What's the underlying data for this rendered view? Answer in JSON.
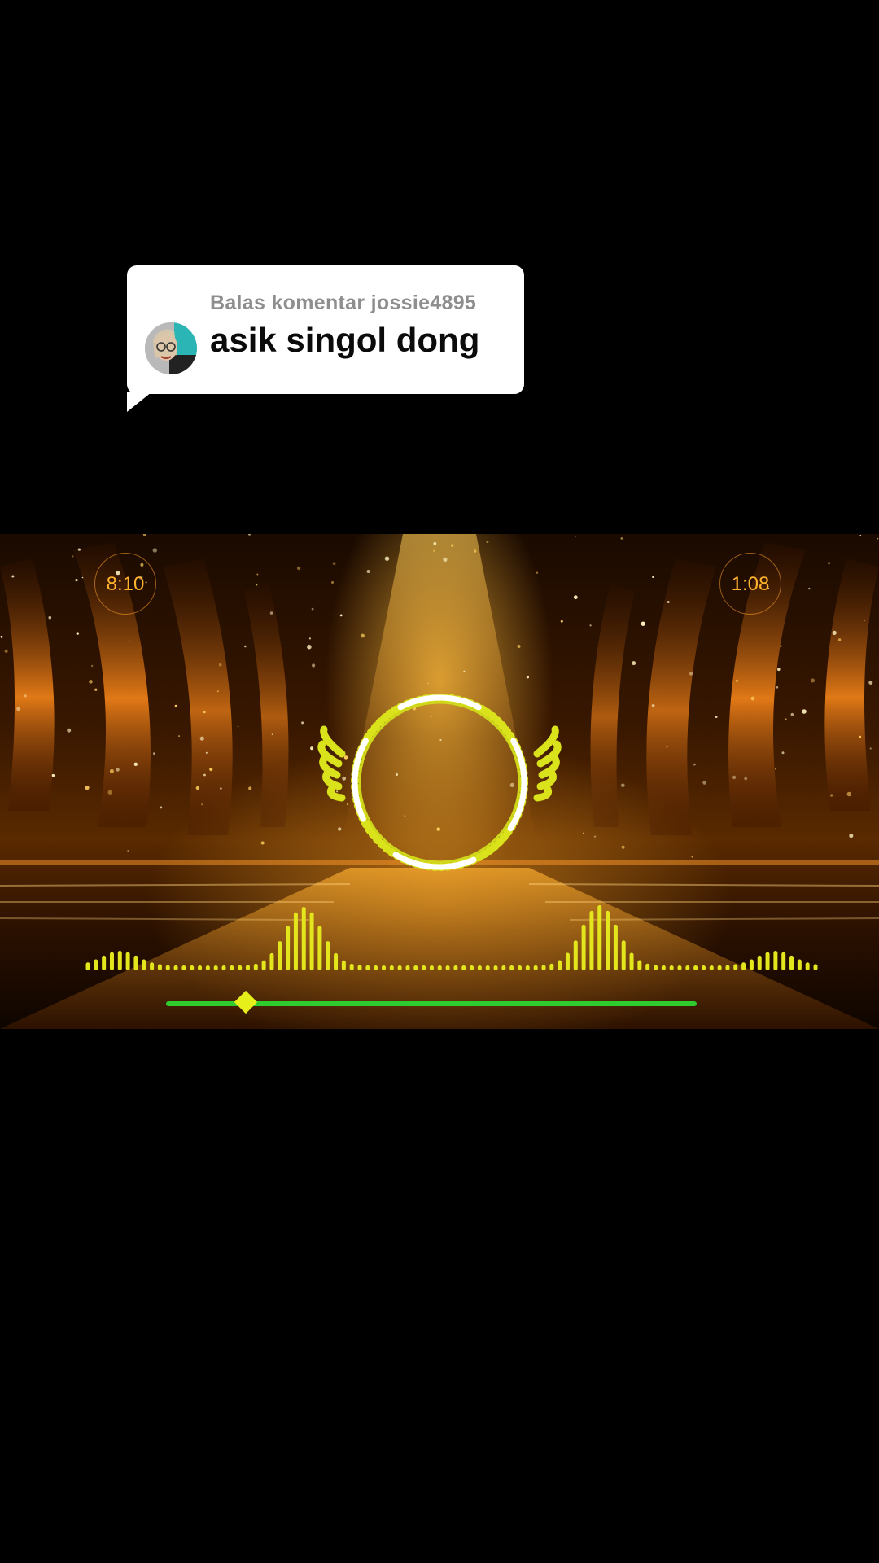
{
  "reply_comment": {
    "header": "Balas komentar jossie4895",
    "text": "asik singol dong",
    "avatar_icon": "user-avatar"
  },
  "player": {
    "elapsed_time": "8:10",
    "remaining_time": "1:08",
    "progress_fraction": 0.15,
    "accent_color": "#e7ef1a",
    "progress_color": "#2ecc2e",
    "timer_color": "#ffb22e"
  }
}
